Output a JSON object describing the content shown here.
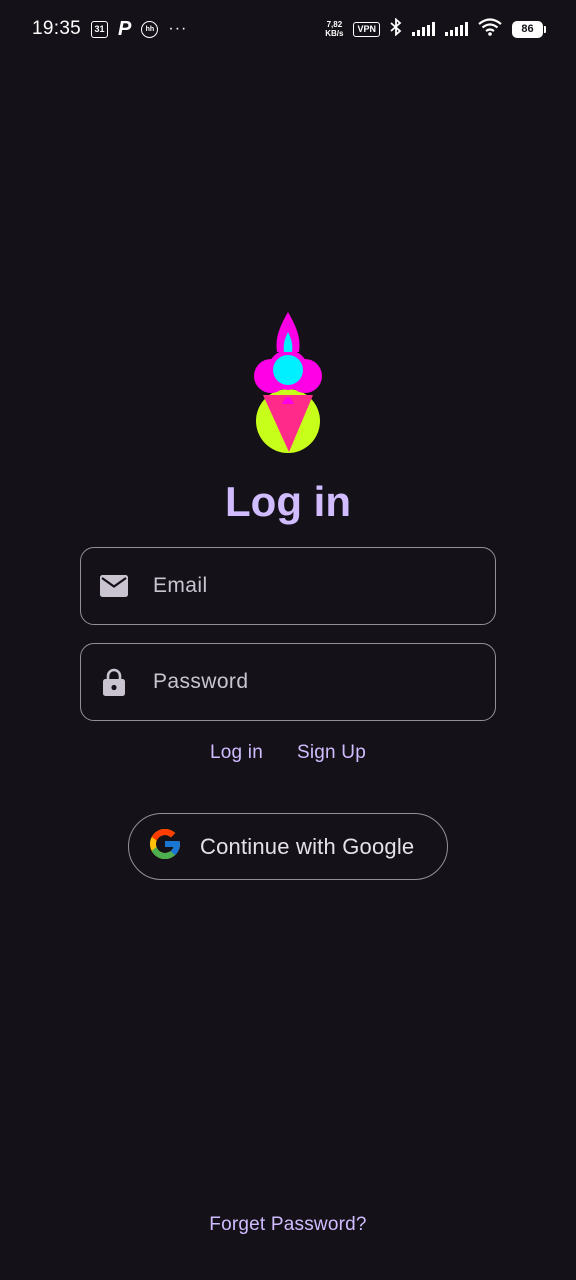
{
  "status_bar": {
    "time": "19:35",
    "calendar_day": "31",
    "p_icon_text": "P",
    "hh_icon_text": "hh",
    "more_text": "···",
    "net_speed_value": "7,82",
    "net_speed_unit": "KB/s",
    "vpn_label": "VPN",
    "battery_level": "86"
  },
  "title": "Log in",
  "email": {
    "placeholder": "Email",
    "icon": "mail-icon"
  },
  "password": {
    "placeholder": "Password",
    "icon": "lock-icon"
  },
  "links": {
    "login": "Log in",
    "signup": "Sign Up"
  },
  "google": {
    "label": "Continue with Google",
    "icon": "google-icon"
  },
  "forget_password": "Forget Password?",
  "colors": {
    "background": "#141218",
    "accent": "#d0bcff",
    "outline": "#938f99",
    "logo_magenta": "#ff00e6",
    "logo_cyan": "#00f0ff",
    "logo_lime": "#c8ff1a",
    "logo_pink": "#ff2a8a"
  }
}
